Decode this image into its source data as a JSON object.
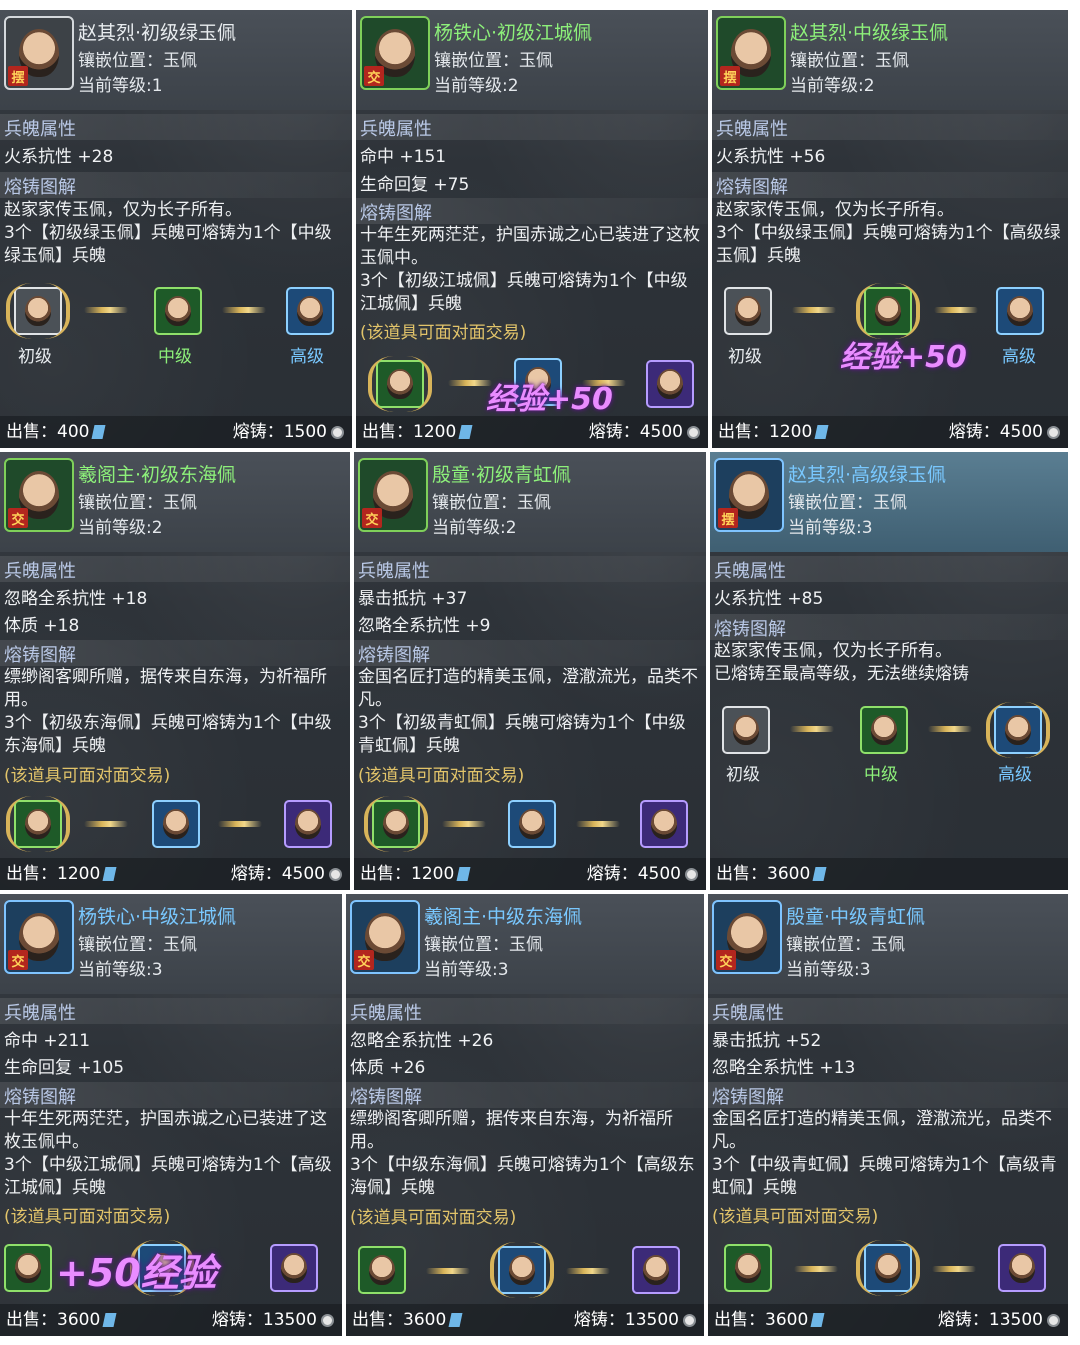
{
  "labels": {
    "slot": "镶嵌位置：玉佩",
    "level_prefix": "当前等级:",
    "attr_header": "兵魄属性",
    "forge_header": "熔铸图解",
    "trade": "(该道具可面对面交易)",
    "sell_prefix": "出售：",
    "forge_prefix": "熔铸：",
    "tier_low": "初级",
    "tier_mid": "中级",
    "tier_high": "高级",
    "tag_bai": "摆",
    "tag_jiao": "交",
    "exp_text_1": "经验+50",
    "exp_text_2": "经验+50",
    "exp_text_3": "+50经验"
  },
  "cards": [
    {
      "title": "赵其烈·初级绿玉佩",
      "level": "1",
      "stats": [
        "火系抗性 +28"
      ],
      "desc": "赵家家传玉佩，仅为长子所有。",
      "forge": "3个【初级绿玉佩】兵魄可熔铸为1个【中级绿玉佩】兵魄",
      "sell": "400",
      "forge_cost": "1500"
    },
    {
      "title": "杨铁心·初级江城佩",
      "level": "2",
      "stats": [
        "命中 +151",
        "生命回复 +75"
      ],
      "desc": "十年生死两茫茫，护国赤诚之心已装进了这枚玉佩中。",
      "forge": "3个【初级江城佩】兵魄可熔铸为1个【中级江城佩】兵魄",
      "sell": "1200",
      "forge_cost": "4500"
    },
    {
      "title": "赵其烈·中级绿玉佩",
      "level": "2",
      "stats": [
        "火系抗性 +56"
      ],
      "desc": "赵家家传玉佩，仅为长子所有。",
      "forge": "3个【中级绿玉佩】兵魄可熔铸为1个【高级绿玉佩】兵魄",
      "sell": "1200",
      "forge_cost": "4500"
    },
    {
      "title": "羲阁主·初级东海佩",
      "level": "2",
      "stats": [
        "忽略全系抗性 +18",
        "体质 +18"
      ],
      "desc": "缥缈阁客卿所赠，据传来自东海，为祈福所用。",
      "forge": "3个【初级东海佩】兵魄可熔铸为1个【中级东海佩】兵魄",
      "sell": "1200",
      "forge_cost": "4500"
    },
    {
      "title": "殷童·初级青虹佩",
      "level": "2",
      "stats": [
        "暴击抵抗 +37",
        "忽略全系抗性 +9"
      ],
      "desc": "金国名匠打造的精美玉佩，澄澈流光，品类不凡。",
      "forge": "3个【初级青虹佩】兵魄可熔铸为1个【中级青虹佩】兵魄",
      "sell": "1200",
      "forge_cost": "4500"
    },
    {
      "title": "赵其烈·高级绿玉佩",
      "level": "3",
      "stats": [
        "火系抗性 +85"
      ],
      "desc": "赵家家传玉佩，仅为长子所有。",
      "forge": "已熔铸至最高等级，无法继续熔铸",
      "sell": "3600",
      "forge_cost": ""
    },
    {
      "title": "杨铁心·中级江城佩",
      "level": "3",
      "stats": [
        "命中 +211",
        "生命回复 +105"
      ],
      "desc": "十年生死两茫茫，护国赤诚之心已装进了这枚玉佩中。",
      "forge": "3个【中级江城佩】兵魄可熔铸为1个【高级江城佩】兵魄",
      "sell": "3600",
      "forge_cost": "13500"
    },
    {
      "title": "羲阁主·中级东海佩",
      "level": "3",
      "stats": [
        "忽略全系抗性 +26",
        "体质 +26"
      ],
      "desc": "缥缈阁客卿所赠，据传来自东海，为祈福所用。",
      "forge": "3个【中级东海佩】兵魄可熔铸为1个【高级东海佩】兵魄",
      "sell": "3600",
      "forge_cost": "13500"
    },
    {
      "title": "殷童·中级青虹佩",
      "level": "3",
      "stats": [
        "暴击抵抗 +52",
        "忽略全系抗性 +13"
      ],
      "desc": "金国名匠打造的精美玉佩，澄澈流光，品类不凡。",
      "forge": "3个【中级青虹佩】兵魄可熔铸为1个【高级青虹佩】兵魄",
      "sell": "3600",
      "forge_cost": "13500"
    }
  ]
}
